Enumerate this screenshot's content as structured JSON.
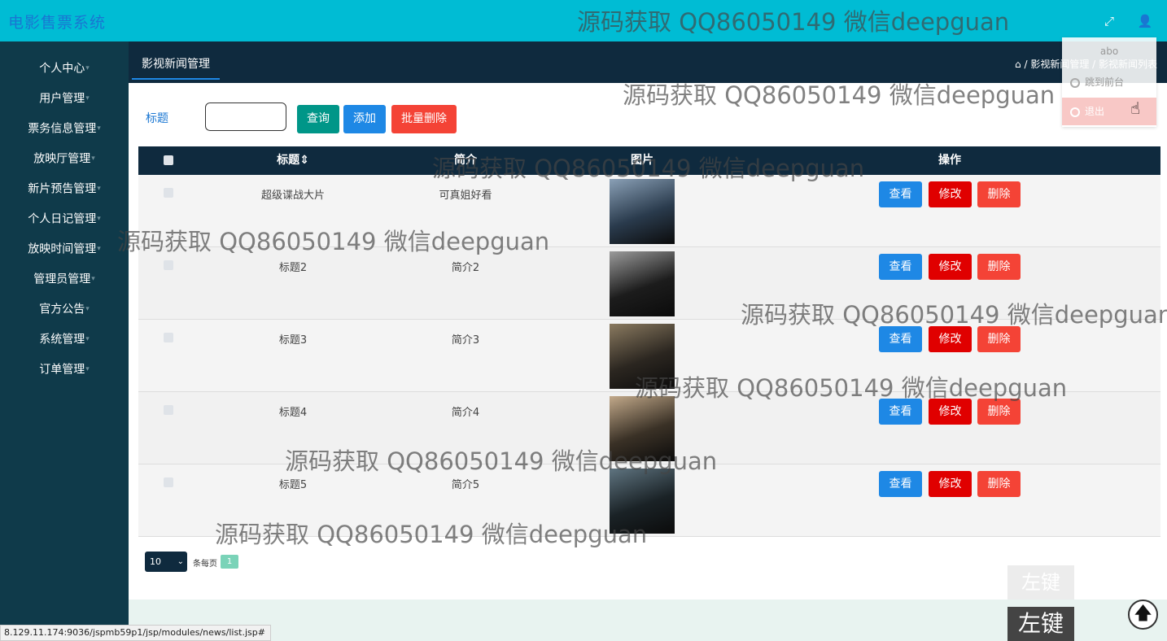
{
  "app": {
    "title": "电影售票系统"
  },
  "topbar": {
    "fullscreen_icon": "⤢",
    "user_icon": "👤"
  },
  "sidebar": {
    "items": [
      {
        "label": "个人中心"
      },
      {
        "label": "用户管理"
      },
      {
        "label": "票务信息管理"
      },
      {
        "label": "放映厅管理"
      },
      {
        "label": "新片预告管理"
      },
      {
        "label": "个人日记管理"
      },
      {
        "label": "放映时间管理"
      },
      {
        "label": "管理员管理"
      },
      {
        "label": "官方公告"
      },
      {
        "label": "系统管理"
      },
      {
        "label": "订单管理"
      }
    ]
  },
  "subheader": {
    "tab": "影视新闻管理",
    "breadcrumb": "⌂ / 影视新闻管理 / 影视新闻列表"
  },
  "filter": {
    "label": "标题",
    "value": "",
    "query": "查询",
    "add": "添加",
    "batch_delete": "批量删除"
  },
  "table": {
    "headers": {
      "title": "标题⇕",
      "intro": "简介",
      "image": "图片",
      "action": "操作"
    },
    "actions": {
      "view": "查看",
      "edit": "修改",
      "delete": "删除"
    },
    "rows": [
      {
        "title": "超级谍战大片",
        "intro": "可真姐好看",
        "poster_colors": [
          "#2a3b4d",
          "#8aa0b6"
        ]
      },
      {
        "title": "标题2",
        "intro": "简介2",
        "poster_colors": [
          "#1c1c1c",
          "#9b9b9b"
        ]
      },
      {
        "title": "标题3",
        "intro": "简介3",
        "poster_colors": [
          "#2b2620",
          "#8a7a60"
        ]
      },
      {
        "title": "标题4",
        "intro": "简介4",
        "poster_colors": [
          "#3a3126",
          "#c2a98a"
        ]
      },
      {
        "title": "标题5",
        "intro": "简介5",
        "poster_colors": [
          "#1a2226",
          "#5f7480"
        ]
      }
    ]
  },
  "pager": {
    "page_size": "10",
    "label": "条每页",
    "current": "1"
  },
  "user_menu": {
    "username": "abo",
    "front": "跳到前台",
    "logout": "退出"
  },
  "watermark": "源码获取 QQ86050149 微信deepguan",
  "overlay": {
    "key_ghost": "左键",
    "key_hint": "左键",
    "scroll_top": "🡅"
  },
  "statusbar": {
    "url": "8.129.11.174:9036/jspmb59p1/jsp/modules/news/list.jsp#"
  }
}
